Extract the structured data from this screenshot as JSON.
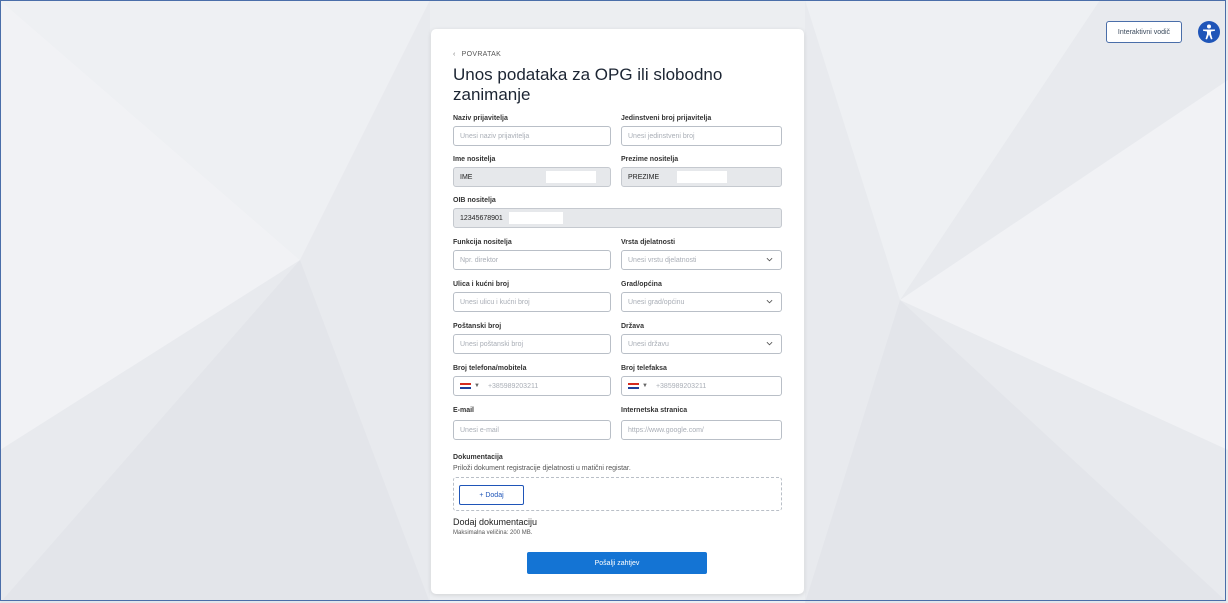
{
  "top": {
    "guide_button": "Interaktivni vodič",
    "accessibility_icon": "accessibility-icon"
  },
  "form": {
    "back_label": "POVRATAK",
    "title": "Unos podataka za OPG ili slobodno zanimanje",
    "fields": {
      "applicant_name": {
        "label": "Naziv prijavitelja",
        "placeholder": "Unesi naziv prijavitelja"
      },
      "applicant_id": {
        "label": "Jedinstveni broj prijavitelja",
        "placeholder": "Unesi jedinstveni broj"
      },
      "holder_first_name": {
        "label": "Ime nositelja",
        "value": "IME"
      },
      "holder_last_name": {
        "label": "Prezime nositelja",
        "value": "PREZIME"
      },
      "holder_oib": {
        "label": "OIB nositelja",
        "value": "12345678901"
      },
      "holder_function": {
        "label": "Funkcija nositelja",
        "placeholder": "Npr. direktor"
      },
      "activity_type": {
        "label": "Vrsta djelatnosti",
        "placeholder": "Unesi vrstu djelatnosti"
      },
      "street": {
        "label": "Ulica i kućni broj",
        "placeholder": "Unesi ulicu i kućni broj"
      },
      "city": {
        "label": "Grad/općina",
        "placeholder": "Unesi grad/općinu"
      },
      "postal": {
        "label": "Poštanski broj",
        "placeholder": "Unesi poštanski broj"
      },
      "country": {
        "label": "Država",
        "placeholder": "Unesi državu"
      },
      "phone": {
        "label": "Broj telefona/mobitela",
        "placeholder": "+385989203211"
      },
      "fax": {
        "label": "Broj telefaksa",
        "placeholder": "+385989203211"
      },
      "email": {
        "label": "E-mail",
        "placeholder": "Unesi e-mail"
      },
      "website": {
        "label": "Internetska stranica",
        "placeholder": "https://www.google.com/"
      }
    },
    "documentation": {
      "title": "Dokumentacija",
      "description": "Priloži dokument registracije djelatnosti u matični registar.",
      "add_button": "+ Dodaj",
      "add_heading": "Dodaj dokumentaciju",
      "max_size": "Maksimalna veličina: 200 MB."
    },
    "submit_label": "Pošalji zahtjev"
  },
  "colors": {
    "primary": "#1474d4",
    "accent_blue": "#1f55b8",
    "background": "#eceef1",
    "flag": [
      "#d52b1e",
      "#ffffff",
      "#1f3f9a"
    ]
  }
}
